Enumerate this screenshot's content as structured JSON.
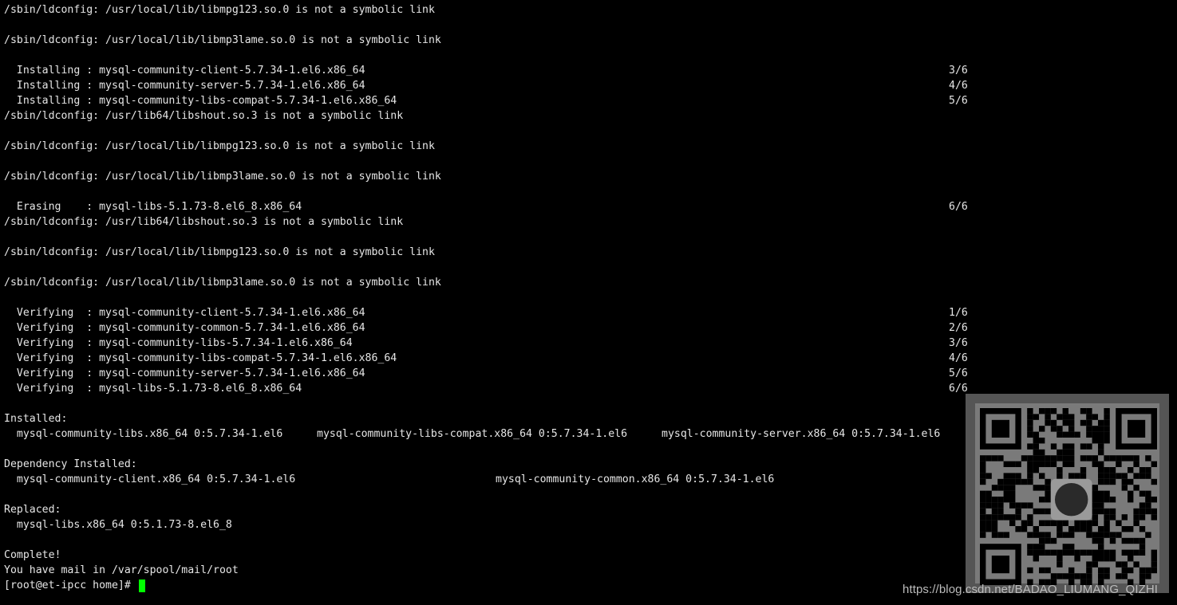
{
  "terminal": {
    "lines": [
      "/sbin/ldconfig: /usr/local/lib/libmpg123.so.0 is not a symbolic link",
      "",
      "/sbin/ldconfig: /usr/local/lib/libmp3lame.so.0 is not a symbolic link",
      "",
      "  Installing : mysql-community-client-5.7.34-1.el6.x86_64",
      "  Installing : mysql-community-server-5.7.34-1.el6.x86_64",
      "  Installing : mysql-community-libs-compat-5.7.34-1.el6.x86_64",
      "/sbin/ldconfig: /usr/lib64/libshout.so.3 is not a symbolic link",
      "",
      "/sbin/ldconfig: /usr/local/lib/libmpg123.so.0 is not a symbolic link",
      "",
      "/sbin/ldconfig: /usr/local/lib/libmp3lame.so.0 is not a symbolic link",
      "",
      "  Erasing    : mysql-libs-5.1.73-8.el6_8.x86_64",
      "/sbin/ldconfig: /usr/lib64/libshout.so.3 is not a symbolic link",
      "",
      "/sbin/ldconfig: /usr/local/lib/libmpg123.so.0 is not a symbolic link",
      "",
      "/sbin/ldconfig: /usr/local/lib/libmp3lame.so.0 is not a symbolic link",
      "",
      "  Verifying  : mysql-community-client-5.7.34-1.el6.x86_64",
      "  Verifying  : mysql-community-common-5.7.34-1.el6.x86_64",
      "  Verifying  : mysql-community-libs-5.7.34-1.el6.x86_64",
      "  Verifying  : mysql-community-libs-compat-5.7.34-1.el6.x86_64",
      "  Verifying  : mysql-community-server-5.7.34-1.el6.x86_64",
      "  Verifying  : mysql-libs-5.1.73-8.el6_8.x86_64",
      "",
      "Installed:",
      "  mysql-community-libs.x86_64 0:5.7.34-1.el6",
      "",
      "Dependency Installed:",
      "  mysql-community-client.x86_64 0:5.7.34-1.el6",
      "",
      "Replaced:",
      "  mysql-libs.x86_64 0:5.1.73-8.el6_8",
      "",
      "Complete!",
      "You have mail in /var/spool/mail/root",
      "[root@et-ipcc home]# "
    ],
    "progress": {
      "4": "3/6",
      "5": "4/6",
      "6": "5/6",
      "13": "6/6",
      "20": "1/6",
      "21": "2/6",
      "22": "3/6",
      "23": "4/6",
      "24": "5/6",
      "25": "6/6"
    },
    "extra_columns": {
      "28": [
        "mysql-community-libs-compat.x86_64 0:5.7.34-1.el6",
        "mysql-community-server.x86_64 0:5.7.34-1.el6"
      ],
      "31": [
        "mysql-community-common.x86_64 0:5.7.34-1.el6"
      ]
    },
    "cursor_color": "#00ff00"
  },
  "watermark": {
    "text": "https://blog.csdn.net/BADAO_LIUMANG_QIZHI"
  },
  "qr_code": {
    "icon": "qr-code-icon"
  }
}
